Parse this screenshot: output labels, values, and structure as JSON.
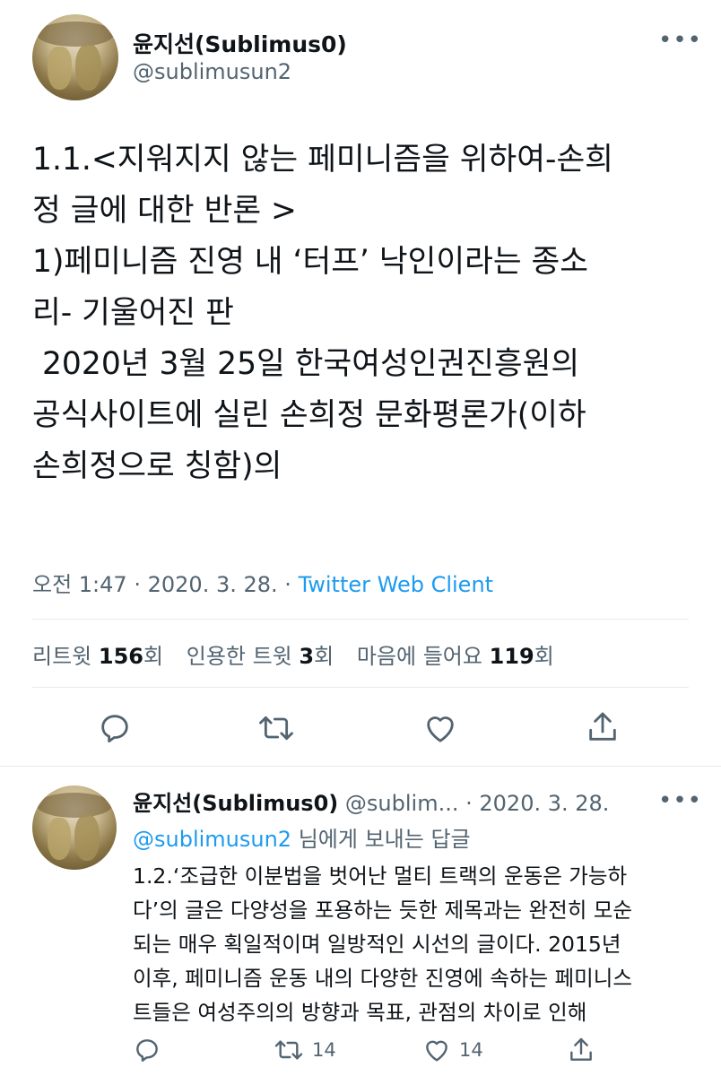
{
  "tweet": {
    "author_name": "윤지선(Sublimus0)",
    "author_handle": "@sublimusun2",
    "more_icon": "more-dots-icon",
    "text": "1.1.<지워지지 않는 페미니즘을 위하여-손희\n정 글에 대한 반론 >\n1)페미니즘 진영 내 ‘터프’ 낙인이라는 종소\n리- 기울어진 판\n 2020년 3월 25일 한국여성인권진흥원의\n공식사이트에 실린 손희정 문화평론가(이하\n손희정으로 칭함)의",
    "time": "오전 1:47",
    "date": "2020. 3. 28.",
    "separator": "·",
    "client": "Twitter Web Client",
    "stats": {
      "retweets_label": "리트윗",
      "retweets_count": "156",
      "retweets_unit": "회",
      "quotes_label": "인용한 트윗",
      "quotes_count": "3",
      "quotes_unit": "회",
      "likes_label": "마음에 들어요",
      "likes_count": "119",
      "likes_unit": "회"
    }
  },
  "reply": {
    "author_name": "윤지선(Sublimus0)",
    "author_handle": "@sublim...",
    "separator": "·",
    "date": "2020. 3. 28.",
    "reply_to_mention": "@sublimusun2",
    "reply_to_suffix": " 님에게 보내는 답글",
    "text": "1.2.‘조급한 이분법을 벗어난 멀티 트랙의 운동은 가능하\n다’의 글은 다양성을 포용하는 듯한 제목과는 완전히 모순\n되는 매우 획일적이며 일방적인 시선의 글이다. 2015년\n이후, 페미니즘 운동 내의 다양한 진영에 속하는 페미니스\n트들은 여성주의의 방향과 목표, 관점의 차이로 인해",
    "retweet_count": "14",
    "like_count": "14"
  },
  "colors": {
    "text": "#0f1419",
    "secondary": "#536471",
    "accent": "#1d9bf0",
    "divider": "#e6ecf0"
  }
}
